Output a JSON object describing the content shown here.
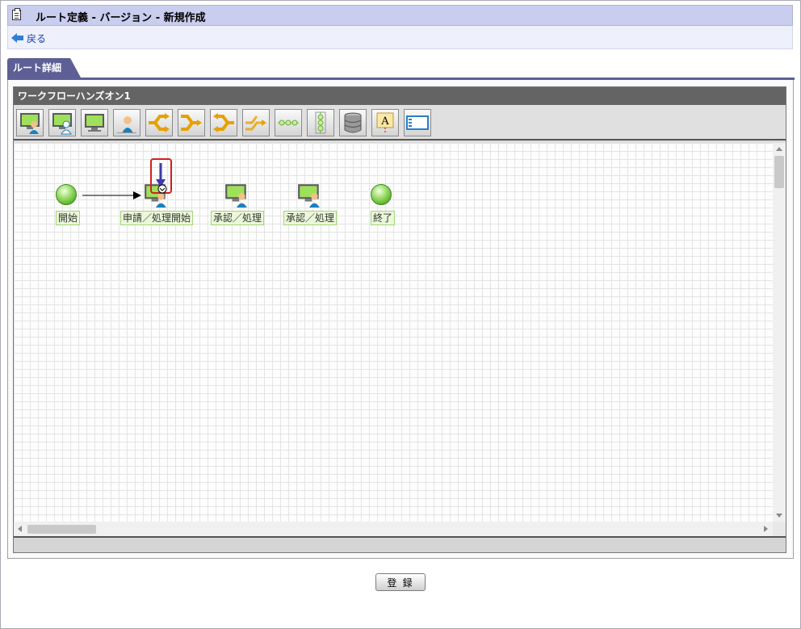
{
  "window": {
    "title": "ルート定義 - バージョン - 新規作成"
  },
  "nav": {
    "back_label": "戻る"
  },
  "tabs": [
    {
      "label": "ルート詳細"
    }
  ],
  "editor": {
    "route_name": "ワークフローハンズオン1",
    "toolbar": [
      {
        "name": "user-node-tool",
        "icon": "monitor-user-icon"
      },
      {
        "name": "user-node-variant-tool",
        "icon": "monitor-user-outline-icon"
      },
      {
        "name": "system-node-tool",
        "icon": "monitor-icon"
      },
      {
        "name": "person-node-tool",
        "icon": "person-icon"
      },
      {
        "name": "branch-start-tool",
        "icon": "branch-split-icon"
      },
      {
        "name": "branch-end-tool",
        "icon": "branch-merge-icon"
      },
      {
        "name": "parallel-start-tool",
        "icon": "parallel-split-icon"
      },
      {
        "name": "parallel-end-tool",
        "icon": "parallel-merge-icon"
      },
      {
        "name": "horizontal-flow-tool",
        "icon": "horizontal-nodes-icon"
      },
      {
        "name": "vertical-flow-tool",
        "icon": "vertical-nodes-icon"
      },
      {
        "name": "database-tool",
        "icon": "database-icon"
      },
      {
        "name": "label-tool",
        "icon": "text-label-icon"
      },
      {
        "name": "window-tool",
        "icon": "window-icon"
      }
    ],
    "nodes": [
      {
        "name": "start-node",
        "label": "開始",
        "type": "start"
      },
      {
        "name": "apply-node",
        "label": "申請／処理開始",
        "type": "user"
      },
      {
        "name": "approve-node-1",
        "label": "承認／処理",
        "type": "user"
      },
      {
        "name": "approve-node-2",
        "label": "承認／処理",
        "type": "user"
      },
      {
        "name": "end-node",
        "label": "終了",
        "type": "end"
      }
    ]
  },
  "actions": {
    "register_label": "登 録"
  },
  "colors": {
    "title_bar": "#c9cdee",
    "tab": "#5d5f96",
    "highlight": "#cc2222",
    "node_green": "#5cb329",
    "arrow": "#3a3ab0"
  }
}
